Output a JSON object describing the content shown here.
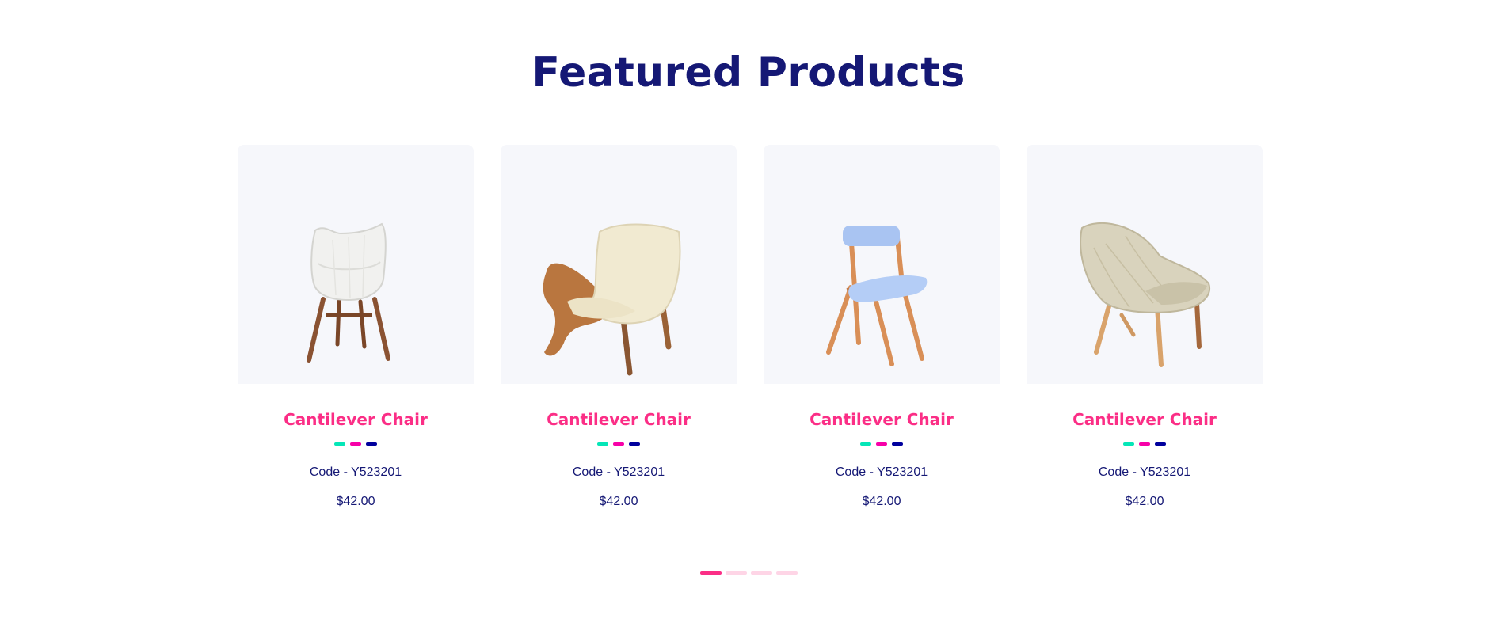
{
  "section": {
    "title": "Featured Products"
  },
  "products": [
    {
      "name": "Cantilever Chair",
      "code": "Code - Y523201",
      "price": "$42.00",
      "image": "white-shell-chair"
    },
    {
      "name": "Cantilever Chair",
      "code": "Code - Y523201",
      "price": "$42.00",
      "image": "shell-lounge-chair"
    },
    {
      "name": "Cantilever Chair",
      "code": "Code - Y523201",
      "price": "$42.00",
      "image": "folding-blue-chair"
    },
    {
      "name": "Cantilever Chair",
      "code": "Code - Y523201",
      "price": "$42.00",
      "image": "woven-lounge-chair"
    }
  ],
  "swatch_colors": [
    "#05e6b7",
    "#f701a8",
    "#00009d"
  ],
  "pagination": {
    "total": 4,
    "active": 0
  },
  "colors": {
    "title": "#151875",
    "accent": "#fb2e86",
    "card_bg": "#f6f7fb",
    "inactive_dot": "#fed5e6"
  }
}
